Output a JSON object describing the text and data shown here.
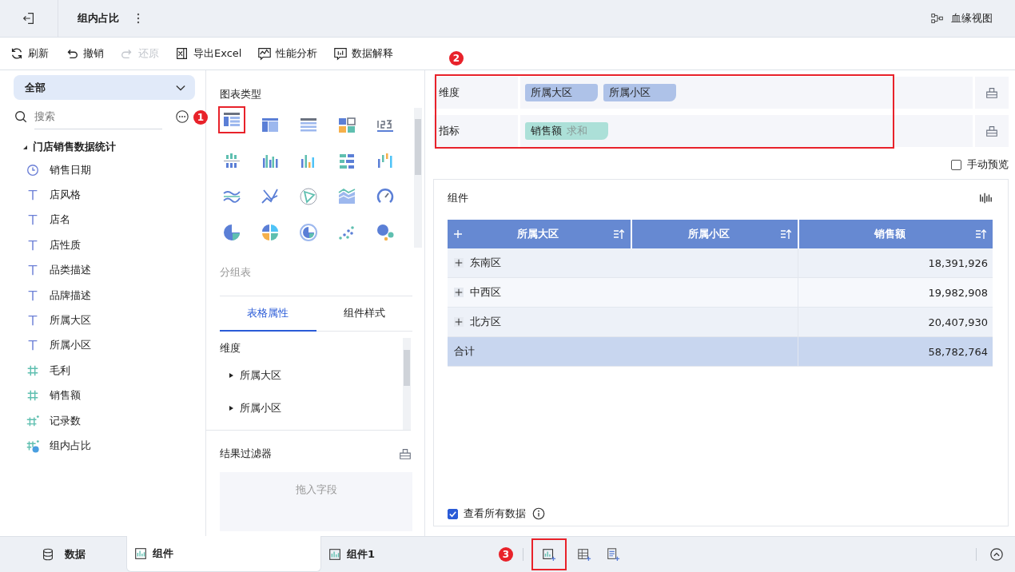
{
  "header": {
    "title": "组内占比",
    "lineage": "血缘视图"
  },
  "toolbar": [
    {
      "label": "刷新",
      "kind": "refresh",
      "disabled": false
    },
    {
      "label": "撤销",
      "kind": "undo",
      "disabled": false
    },
    {
      "label": "还原",
      "kind": "redo",
      "disabled": true
    },
    {
      "label": "导出Excel",
      "kind": "excel",
      "disabled": false
    },
    {
      "label": "性能分析",
      "kind": "perf",
      "disabled": false
    },
    {
      "label": "数据解释",
      "kind": "explain",
      "disabled": false
    }
  ],
  "fields": {
    "scope": "全部",
    "search": {
      "placeholder": "搜索"
    },
    "group": {
      "label": "门店销售数据统计",
      "expanded": true,
      "children": [
        {
          "label": "销售日期",
          "kind": "date"
        },
        {
          "label": "店风格",
          "kind": "text"
        },
        {
          "label": "店名",
          "kind": "text"
        },
        {
          "label": "店性质",
          "kind": "text"
        },
        {
          "label": "品类描述",
          "kind": "text"
        },
        {
          "label": "品牌描述",
          "kind": "text"
        },
        {
          "label": "所属大区",
          "kind": "text"
        },
        {
          "label": "所属小区",
          "kind": "text"
        },
        {
          "label": "毛利",
          "kind": "number"
        },
        {
          "label": "销售额",
          "kind": "number"
        },
        {
          "label": "记录数",
          "kind": "count"
        },
        {
          "label": "组内占比",
          "kind": "calc"
        }
      ]
    }
  },
  "chart_panel": {
    "title": "图表类型",
    "hint": "分组表",
    "tabs": [
      {
        "label": "表格属性",
        "selected": true
      },
      {
        "label": "组件样式",
        "selected": false
      }
    ],
    "section": "维度",
    "items": [
      {
        "label": "所属大区",
        "expanded": false
      },
      {
        "label": "所属小区",
        "expanded": false
      }
    ],
    "filter": {
      "title": "结果过滤器",
      "placeholder": "拖入字段"
    }
  },
  "shelves": [
    {
      "label": "维度",
      "pills": [
        {
          "text": "所属大区",
          "kind": "dimension"
        },
        {
          "text": "所属小区",
          "kind": "dimension"
        }
      ]
    },
    {
      "label": "指标",
      "pills": [
        {
          "text": "销售额",
          "agg": "求和",
          "kind": "measure"
        }
      ]
    }
  ],
  "manual_preview": {
    "label": "手动预览",
    "checked": false
  },
  "widget": {
    "title": "组件",
    "columns": [
      "所属大区",
      "所属小区",
      "销售额"
    ],
    "rows": [
      {
        "region": "东南区",
        "value": "18,391,926"
      },
      {
        "region": "中西区",
        "value": "19,982,908"
      },
      {
        "region": "北方区",
        "value": "20,407,930"
      }
    ],
    "total": {
      "label": "合计",
      "value": "58,782,764"
    }
  },
  "show_all": {
    "label": "查看所有数据",
    "checked": true
  },
  "bottom_tabs": [
    {
      "label": "数据",
      "kind": "data",
      "selected": false
    },
    {
      "label": "组件",
      "kind": "widget",
      "selected": true
    },
    {
      "label": "组件1",
      "kind": "widget",
      "selected": false
    }
  ],
  "annotations": [
    {
      "label": "1"
    },
    {
      "label": "2"
    },
    {
      "label": "3"
    }
  ]
}
